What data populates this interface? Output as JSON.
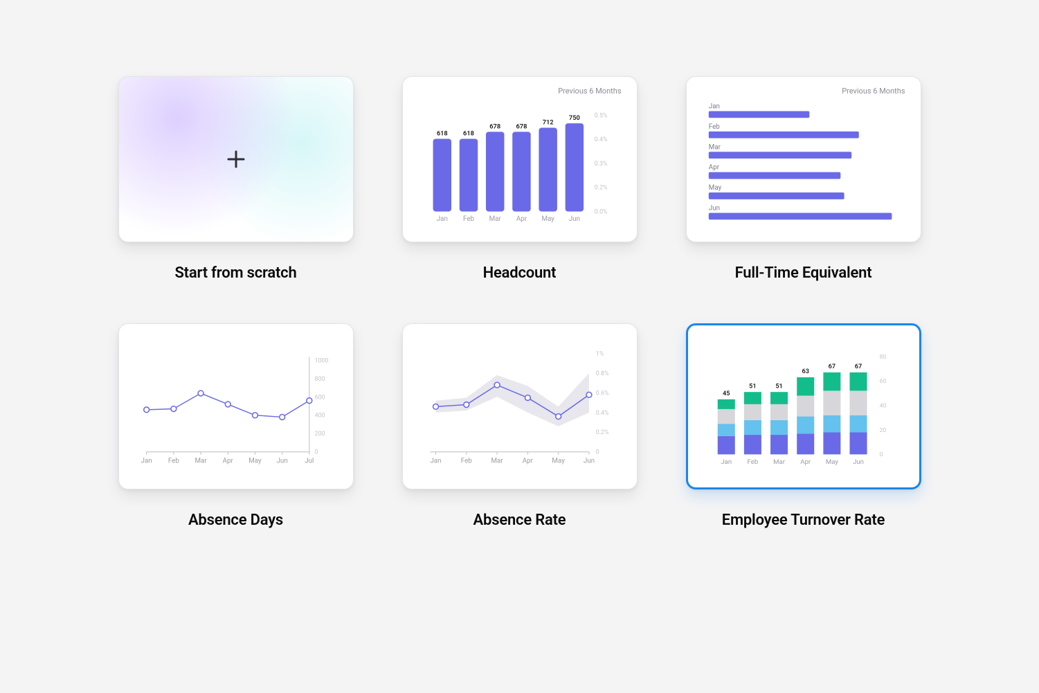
{
  "tiles": {
    "scratch": {
      "title": "Start from scratch"
    },
    "headcount": {
      "title": "Headcount",
      "subtitle": "Previous 6 Months"
    },
    "fte": {
      "title": "Full-Time Equivalent",
      "subtitle": "Previous 6 Months"
    },
    "absence_days": {
      "title": "Absence Days"
    },
    "absence_rate": {
      "title": "Absence Rate"
    },
    "turnover": {
      "title": "Employee Turnover Rate"
    }
  },
  "chart_data": [
    {
      "id": "headcount",
      "type": "bar",
      "subtitle": "Previous 6 Months",
      "categories": [
        "Jan",
        "Feb",
        "Mar",
        "Apr",
        "May",
        "Jun"
      ],
      "values": [
        618,
        618,
        678,
        678,
        712,
        750
      ],
      "secondary_axis_ticks": [
        "0.0%",
        "0.2%",
        "0.3%",
        "0.4%",
        "0.5%"
      ],
      "color": "#6a6ae8"
    },
    {
      "id": "fte",
      "type": "hbar",
      "subtitle": "Previous 6 Months",
      "categories": [
        "Jan",
        "Feb",
        "Mar",
        "Apr",
        "May",
        "Jun"
      ],
      "values": [
        55,
        82,
        78,
        72,
        74,
        100
      ],
      "color": "#6a6ae8"
    },
    {
      "id": "absence_days",
      "type": "line",
      "categories": [
        "Jan",
        "Feb",
        "Mar",
        "Apr",
        "May",
        "Jun",
        "Jul"
      ],
      "values": [
        460,
        470,
        640,
        520,
        400,
        380,
        560
      ],
      "y_ticks": [
        0,
        200,
        400,
        600,
        800,
        1000
      ],
      "color": "#6a6ae8"
    },
    {
      "id": "absence_rate",
      "type": "line-band",
      "categories": [
        "Jan",
        "Feb",
        "Mar",
        "Apr",
        "May",
        "Jun"
      ],
      "values": [
        0.46,
        0.48,
        0.68,
        0.55,
        0.36,
        0.58
      ],
      "band_low": [
        0.4,
        0.42,
        0.56,
        0.4,
        0.26,
        0.4
      ],
      "band_high": [
        0.52,
        0.55,
        0.78,
        0.67,
        0.46,
        0.8
      ],
      "y_ticks": [
        "0",
        "0.2%",
        "0.4%",
        "0.6%",
        "0.8%",
        "1%"
      ],
      "color": "#6a6ae8"
    },
    {
      "id": "turnover",
      "type": "stacked-bar",
      "categories": [
        "Jan",
        "Feb",
        "Mar",
        "Apr",
        "May",
        "Jun"
      ],
      "totals": [
        45,
        51,
        51,
        63,
        67,
        67
      ],
      "series": [
        {
          "name": "purple",
          "color": "#6a6ae8",
          "values": [
            15,
            16,
            16,
            17,
            18,
            18
          ]
        },
        {
          "name": "lightblue",
          "color": "#65c1ee",
          "values": [
            10,
            12,
            12,
            14,
            14,
            14
          ]
        },
        {
          "name": "grey",
          "color": "#d6d6db",
          "values": [
            12,
            13,
            13,
            17,
            20,
            20
          ]
        },
        {
          "name": "green",
          "color": "#13bd8b",
          "values": [
            8,
            10,
            10,
            15,
            15,
            15
          ]
        }
      ],
      "y_ticks": [
        0,
        20,
        40,
        60,
        80
      ]
    }
  ]
}
